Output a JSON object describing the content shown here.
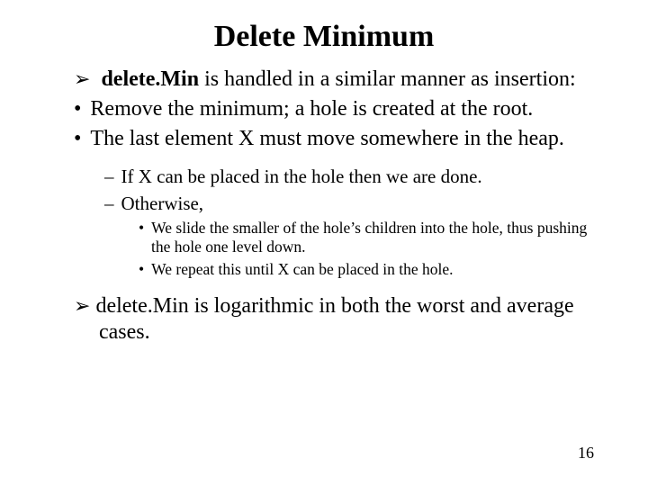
{
  "title": "Delete Minimum",
  "b1_strong": "delete.Min",
  "b1_rest": " is handled in a similar manner as insertion:",
  "b2": "Remove the minimum; a hole is created at the root.",
  "b3": "The last element X must move somewhere in the heap.",
  "s1": "If X can be placed in the hole then we are done.",
  "s2": "Otherwise,",
  "t1": "We slide the smaller of the hole’s children into the hole, thus pushing the hole one level down.",
  "t2": "We repeat this until X can be placed in the hole.",
  "b4": "delete.Min is logarithmic in both the worst and average cases.",
  "page": "16"
}
